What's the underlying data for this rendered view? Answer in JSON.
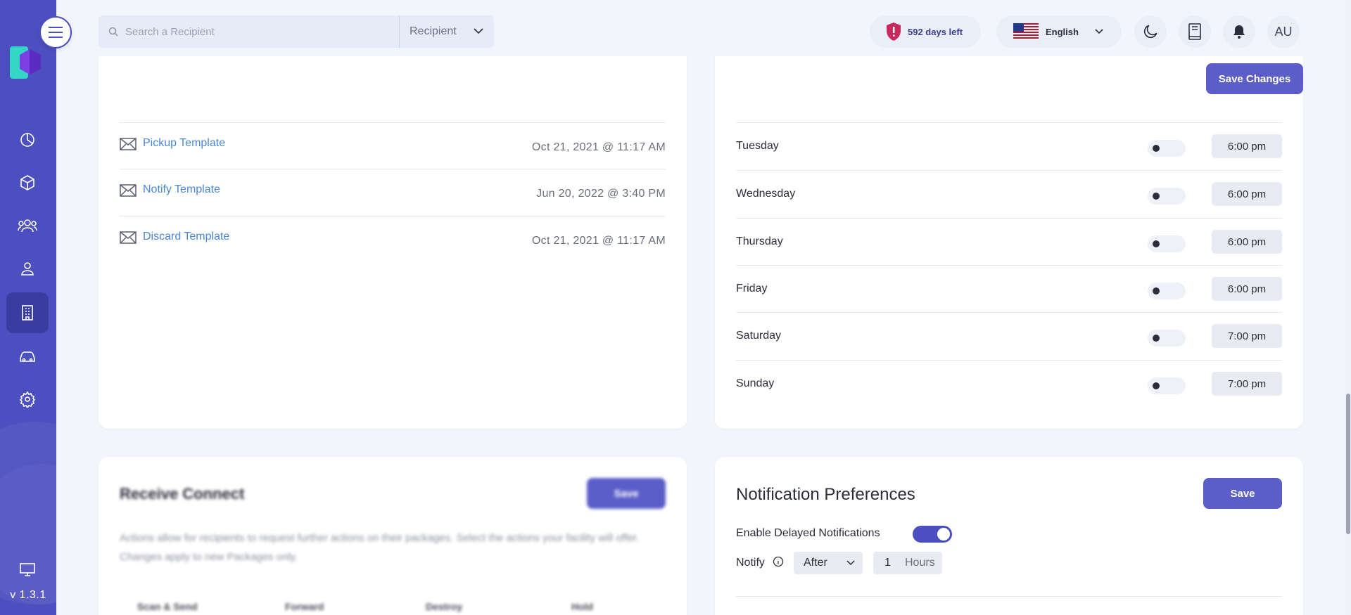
{
  "app": {
    "version": "v 1.3.1"
  },
  "search": {
    "placeholder": "Search a Recipient",
    "type_selected": "Recipient"
  },
  "header": {
    "days_left": "592 days left",
    "language": "English",
    "avatar_initials": "AU",
    "save_changes_label": "Save Changes"
  },
  "templates": [
    {
      "name": "Pickup Template",
      "date": "Oct 21, 2021 @ 11:17 AM"
    },
    {
      "name": "Notify Template",
      "date": "Jun 20, 2022 @ 3:40 PM"
    },
    {
      "name": "Discard Template",
      "date": "Oct 21, 2021 @ 11:17 AM"
    }
  ],
  "schedule": [
    {
      "day": "Tuesday",
      "time": "6:00 pm",
      "enabled": false
    },
    {
      "day": "Wednesday",
      "time": "6:00 pm",
      "enabled": false
    },
    {
      "day": "Thursday",
      "time": "6:00 pm",
      "enabled": false
    },
    {
      "day": "Friday",
      "time": "6:00 pm",
      "enabled": false
    },
    {
      "day": "Saturday",
      "time": "7:00 pm",
      "enabled": false
    },
    {
      "day": "Sunday",
      "time": "7:00 pm",
      "enabled": false
    }
  ],
  "receive_connect": {
    "title": "Receive Connect",
    "save_label": "Save",
    "description": "Actions allow for recipients to request further actions on their packages. Select the actions your facility will offer. Changes apply to new Packages only.",
    "columns": [
      "Scan & Send",
      "Forward",
      "Destroy",
      "Hold"
    ]
  },
  "notification_prefs": {
    "title": "Notification Preferences",
    "save_label": "Save",
    "delayed_label": "Enable Delayed Notifications",
    "delayed_enabled": true,
    "notify_label": "Notify",
    "timing": "After",
    "amount": "1",
    "unit": "Hours"
  },
  "colors": {
    "sidebar": "#4c4fbf",
    "accent": "#5b5ec9",
    "link": "#4a86d6",
    "page_bg": "#f2f5fb"
  }
}
